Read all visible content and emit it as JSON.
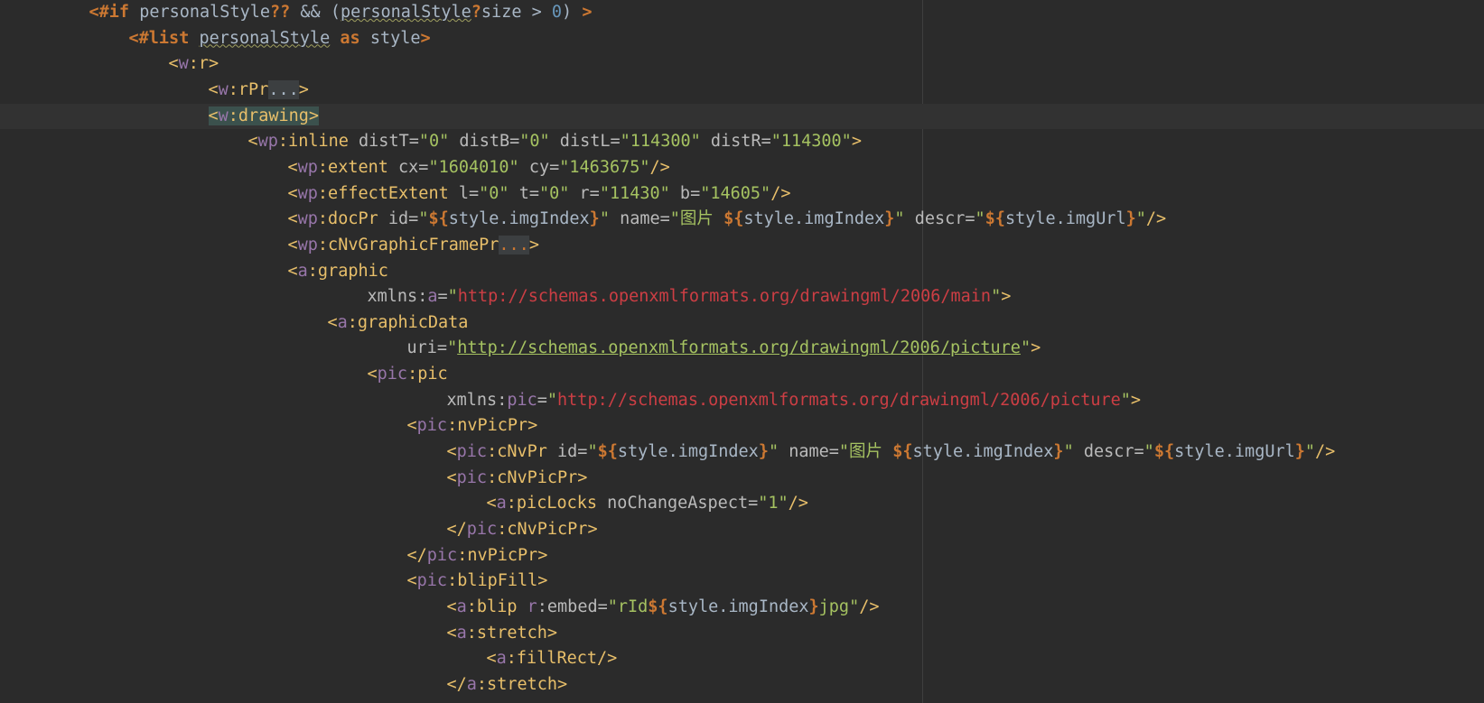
{
  "lines": [
    {
      "indent": 2,
      "tokens": [
        [
          "kw",
          "<#if"
        ],
        [
          "op",
          " personalStyle"
        ],
        [
          "kw",
          "??"
        ],
        [
          "op",
          " && ("
        ],
        [
          "squig",
          "personalStyle"
        ],
        [
          "kw",
          "?"
        ],
        [
          "op",
          "size > "
        ],
        [
          "num",
          "0"
        ],
        [
          "op",
          ") "
        ],
        [
          "kw",
          ">"
        ]
      ]
    },
    {
      "indent": 3,
      "tokens": [
        [
          "kw",
          "<#list"
        ],
        [
          "op",
          " "
        ],
        [
          "squig",
          "personalStyle"
        ],
        [
          "op",
          " "
        ],
        [
          "kw",
          "as"
        ],
        [
          "op",
          " style"
        ],
        [
          "kw",
          ">"
        ]
      ]
    },
    {
      "indent": 4,
      "tokens": [
        [
          "tag",
          "<"
        ],
        [
          "ns",
          "w"
        ],
        [
          "tag",
          ":r>"
        ]
      ]
    },
    {
      "indent": 5,
      "tokens": [
        [
          "tag",
          "<"
        ],
        [
          "ns",
          "w"
        ],
        [
          "tag",
          ":rPr"
        ],
        [
          "fold",
          "..."
        ],
        [
          "tag",
          ">"
        ]
      ]
    },
    {
      "indent": 5,
      "current": true,
      "tokens": [
        [
          "hl",
          "<"
        ],
        [
          "hlns",
          "w"
        ],
        [
          "hl",
          ":drawing>"
        ]
      ]
    },
    {
      "indent": 6,
      "tokens": [
        [
          "tag",
          "<"
        ],
        [
          "ns",
          "wp"
        ],
        [
          "tag",
          ":inline"
        ],
        [
          "attr",
          " distT="
        ],
        [
          "str",
          "\"0\""
        ],
        [
          "attr",
          " distB="
        ],
        [
          "str",
          "\"0\""
        ],
        [
          "attr",
          " distL="
        ],
        [
          "str",
          "\"114300\""
        ],
        [
          "attr",
          " distR="
        ],
        [
          "str",
          "\"114300\""
        ],
        [
          "tag",
          ">"
        ]
      ]
    },
    {
      "indent": 7,
      "tokens": [
        [
          "tag",
          "<"
        ],
        [
          "ns",
          "wp"
        ],
        [
          "tag",
          ":extent"
        ],
        [
          "attr",
          " cx="
        ],
        [
          "str",
          "\"1604010\""
        ],
        [
          "attr",
          " cy="
        ],
        [
          "str",
          "\"1463675\""
        ],
        [
          "tag",
          "/>"
        ]
      ]
    },
    {
      "indent": 7,
      "tokens": [
        [
          "tag",
          "<"
        ],
        [
          "ns",
          "wp"
        ],
        [
          "tag",
          ":effectExtent"
        ],
        [
          "attr",
          " l="
        ],
        [
          "str",
          "\"0\""
        ],
        [
          "attr",
          " t="
        ],
        [
          "str",
          "\"0\""
        ],
        [
          "attr",
          " r="
        ],
        [
          "str",
          "\"11430\""
        ],
        [
          "attr",
          " b="
        ],
        [
          "str",
          "\"14605\""
        ],
        [
          "tag",
          "/>"
        ]
      ]
    },
    {
      "indent": 7,
      "tokens": [
        [
          "tag",
          "<"
        ],
        [
          "ns",
          "wp"
        ],
        [
          "tag",
          ":docPr"
        ],
        [
          "attr",
          " id="
        ],
        [
          "str",
          "\""
        ],
        [
          "ph",
          "${"
        ],
        [
          "var",
          "style.imgIndex"
        ],
        [
          "ph",
          "}"
        ],
        [
          "str",
          "\""
        ],
        [
          "attr",
          " name="
        ],
        [
          "str",
          "\"图片 "
        ],
        [
          "ph",
          "${"
        ],
        [
          "var",
          "style.imgIndex"
        ],
        [
          "ph",
          "}"
        ],
        [
          "str",
          "\""
        ],
        [
          "attr",
          " descr="
        ],
        [
          "str",
          "\""
        ],
        [
          "ph",
          "${"
        ],
        [
          "var",
          "style.imgUrl"
        ],
        [
          "ph",
          "}"
        ],
        [
          "str",
          "\""
        ],
        [
          "tag",
          "/>"
        ]
      ]
    },
    {
      "indent": 7,
      "tokens": [
        [
          "tag",
          "<"
        ],
        [
          "ns",
          "wp"
        ],
        [
          "tag",
          ":cNvGraphicFramePr"
        ],
        [
          "foldr",
          "..."
        ],
        [
          "tag",
          ">"
        ]
      ]
    },
    {
      "indent": 7,
      "tokens": [
        [
          "tag",
          "<"
        ],
        [
          "ns",
          "a"
        ],
        [
          "tag",
          ":graphic"
        ]
      ]
    },
    {
      "indent": 9,
      "tokens": [
        [
          "attr",
          "xmlns:"
        ],
        [
          "ns",
          "a"
        ],
        [
          "attr",
          "="
        ],
        [
          "str",
          "\""
        ],
        [
          "url",
          "http://schemas.openxmlformats.org/drawingml/2006/main"
        ],
        [
          "str",
          "\""
        ],
        [
          "tag",
          ">"
        ]
      ]
    },
    {
      "indent": 8,
      "tokens": [
        [
          "tag",
          "<"
        ],
        [
          "ns",
          "a"
        ],
        [
          "tag",
          ":graphicData"
        ]
      ]
    },
    {
      "indent": 10,
      "tokens": [
        [
          "attr",
          "uri="
        ],
        [
          "str",
          "\""
        ],
        [
          "urlu",
          "http://schemas.openxmlformats.org/drawingml/2006/picture"
        ],
        [
          "str",
          "\""
        ],
        [
          "tag",
          ">"
        ]
      ]
    },
    {
      "indent": 9,
      "tokens": [
        [
          "tag",
          "<"
        ],
        [
          "ns",
          "pic"
        ],
        [
          "tag",
          ":pic"
        ]
      ]
    },
    {
      "indent": 11,
      "tokens": [
        [
          "attr",
          "xmlns:"
        ],
        [
          "ns",
          "pic"
        ],
        [
          "attr",
          "="
        ],
        [
          "str",
          "\""
        ],
        [
          "url",
          "http://schemas.openxmlformats.org/drawingml/2006/picture"
        ],
        [
          "str",
          "\""
        ],
        [
          "tag",
          ">"
        ]
      ]
    },
    {
      "indent": 10,
      "tokens": [
        [
          "tag",
          "<"
        ],
        [
          "ns",
          "pic"
        ],
        [
          "tag",
          ":nvPicPr>"
        ]
      ]
    },
    {
      "indent": 11,
      "tokens": [
        [
          "tag",
          "<"
        ],
        [
          "ns",
          "pic"
        ],
        [
          "tag",
          ":cNvPr"
        ],
        [
          "attr",
          " id="
        ],
        [
          "str",
          "\""
        ],
        [
          "ph",
          "${"
        ],
        [
          "var",
          "style.imgIndex"
        ],
        [
          "ph",
          "}"
        ],
        [
          "str",
          "\""
        ],
        [
          "attr",
          " name="
        ],
        [
          "str",
          "\"图片 "
        ],
        [
          "ph",
          "${"
        ],
        [
          "var",
          "style.imgIndex"
        ],
        [
          "ph",
          "}"
        ],
        [
          "str",
          "\""
        ],
        [
          "attr",
          " descr="
        ],
        [
          "str",
          "\""
        ],
        [
          "ph",
          "${"
        ],
        [
          "var",
          "style.imgUrl"
        ],
        [
          "ph",
          "}"
        ],
        [
          "str",
          "\""
        ],
        [
          "tag",
          "/>"
        ]
      ]
    },
    {
      "indent": 11,
      "tokens": [
        [
          "tag",
          "<"
        ],
        [
          "ns",
          "pic"
        ],
        [
          "tag",
          ":cNvPicPr>"
        ]
      ]
    },
    {
      "indent": 12,
      "tokens": [
        [
          "tag",
          "<"
        ],
        [
          "ns",
          "a"
        ],
        [
          "tag",
          ":picLocks"
        ],
        [
          "attr",
          " noChangeAspect="
        ],
        [
          "str",
          "\"1\""
        ],
        [
          "tag",
          "/>"
        ]
      ]
    },
    {
      "indent": 11,
      "tokens": [
        [
          "tag",
          "</"
        ],
        [
          "ns",
          "pic"
        ],
        [
          "tag",
          ":cNvPicPr>"
        ]
      ]
    },
    {
      "indent": 10,
      "tokens": [
        [
          "tag",
          "</"
        ],
        [
          "ns",
          "pic"
        ],
        [
          "tag",
          ":nvPicPr>"
        ]
      ]
    },
    {
      "indent": 10,
      "tokens": [
        [
          "tag",
          "<"
        ],
        [
          "ns",
          "pic"
        ],
        [
          "tag",
          ":blipFill>"
        ]
      ]
    },
    {
      "indent": 11,
      "tokens": [
        [
          "tag",
          "<"
        ],
        [
          "ns",
          "a"
        ],
        [
          "tag",
          ":blip"
        ],
        [
          "attr",
          " "
        ],
        [
          "ns",
          "r"
        ],
        [
          "attr",
          ":embed="
        ],
        [
          "str",
          "\"rId"
        ],
        [
          "ph",
          "${"
        ],
        [
          "var",
          "style.imgIndex"
        ],
        [
          "ph",
          "}"
        ],
        [
          "str",
          "jpg\""
        ],
        [
          "tag",
          "/>"
        ]
      ]
    },
    {
      "indent": 11,
      "tokens": [
        [
          "tag",
          "<"
        ],
        [
          "ns",
          "a"
        ],
        [
          "tag",
          ":stretch>"
        ]
      ]
    },
    {
      "indent": 12,
      "tokens": [
        [
          "tag",
          "<"
        ],
        [
          "ns",
          "a"
        ],
        [
          "tag",
          ":fillRect/>"
        ]
      ]
    },
    {
      "indent": 11,
      "tokens": [
        [
          "tag",
          "</"
        ],
        [
          "ns",
          "a"
        ],
        [
          "tag",
          ":stretch>"
        ]
      ]
    }
  ]
}
